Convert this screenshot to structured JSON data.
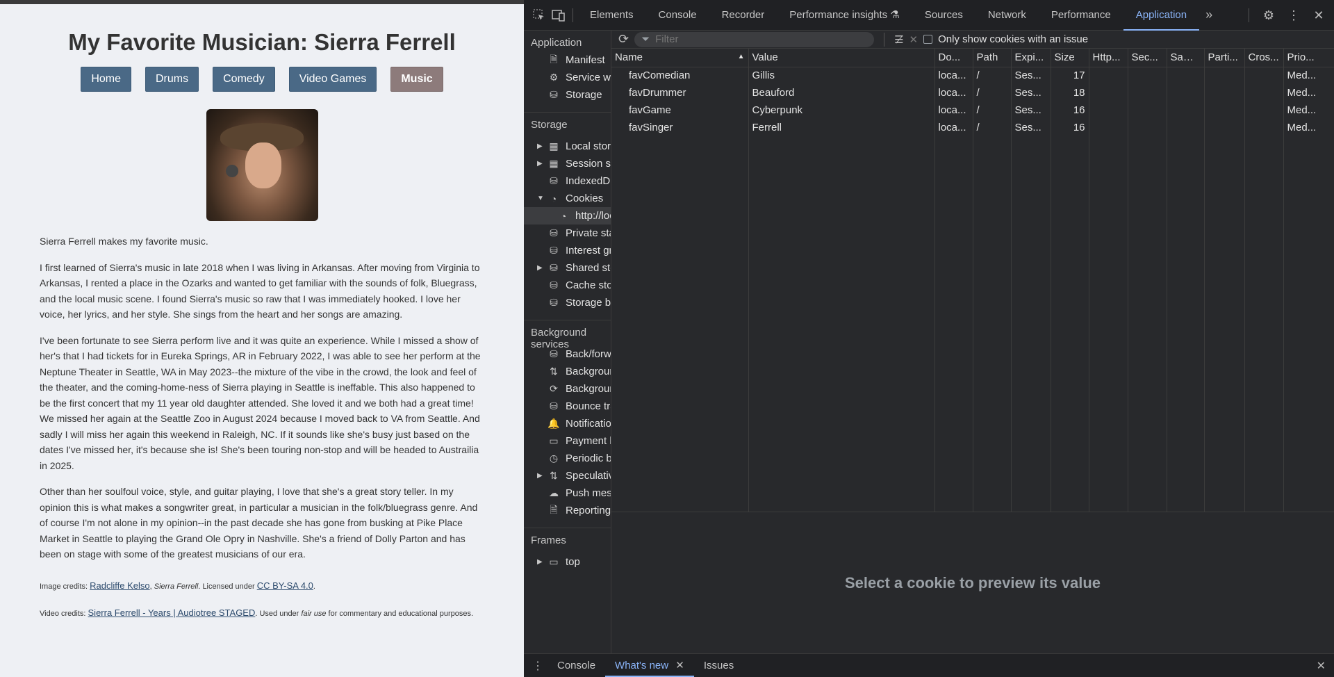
{
  "page": {
    "title": "My Favorite Musician: Sierra Ferrell",
    "nav": [
      "Home",
      "Drums",
      "Comedy",
      "Video Games",
      "Music"
    ],
    "active_nav": "Music",
    "paragraphs": [
      "Sierra Ferrell makes my favorite music.",
      "I first learned of Sierra's music in late 2018 when I was living in Arkansas. After moving from Virginia to Arkansas, I rented a place in the Ozarks and wanted to get familiar with the sounds of folk, Bluegrass, and the local music scene. I found Sierra's music so raw that I was immediately hooked. I love her voice, her lyrics, and her style. She sings from the heart and her songs are amazing.",
      "I've been fortunate to see Sierra perform live and it was quite an experience. While I missed a show of her's that I had tickets for in Eureka Springs, AR in February 2022, I was able to see her perform at the Neptune Theater in Seattle, WA in May 2023--the mixture of the vibe in the crowd, the look and feel of the theater, and the coming-home-ness of Sierra playing in Seattle is ineffable. This also happened to be the first concert that my 11 year old daughter attended. She loved it and we both had a great time! We missed her again at the Seattle Zoo in August 2024 because I moved back to VA from Seattle. And sadly I will miss her again this weekend in Raleigh, NC. If it sounds like she's busy just based on the dates I've missed her, it's because she is! She's been touring non-stop and will be headed to Austrailia in 2025.",
      "Other than her soulfoul voice, style, and guitar playing, I love that she's a great story teller. In my opinion this is what makes a songwriter great, in particular a musician in the folk/bluegrass genre. And of course I'm not alone in my opinion--in the past decade she has gone from busking at Pike Place Market in Seattle to playing the Grand Ole Opry in Nashville. She's a friend of Dolly Parton and has been on stage with some of the greatest musicians of our era."
    ],
    "image_credits": {
      "prefix": "Image credits: ",
      "link": "Radcliffe Kelso",
      "work": "Sierra Ferrell",
      "licensed": ". Licensed under ",
      "license_link": "CC BY-SA 4.0",
      "end": "."
    },
    "video_credits": {
      "prefix": "Video credits: ",
      "link": "Sierra Ferrell - Years | Audiotree STAGED",
      "suffix1": ". Used under ",
      "fair": "fair use",
      "suffix2": " for commentary and educational purposes."
    }
  },
  "devtools": {
    "tabs": [
      "Elements",
      "Console",
      "Recorder",
      "Performance insights",
      "Sources",
      "Network",
      "Performance",
      "Application"
    ],
    "active_tab": "Application",
    "sidebar": {
      "application_header": "Application",
      "application_items": [
        "Manifest",
        "Service workers",
        "Storage"
      ],
      "storage_header": "Storage",
      "storage_items": [
        "Local storage",
        "Session storage",
        "IndexedDB",
        "Cookies",
        "http://localhost",
        "Private state tokens",
        "Interest groups",
        "Shared storage",
        "Cache storage",
        "Storage buckets"
      ],
      "background_header": "Background services",
      "background_items": [
        "Back/forward cache",
        "Background fetch",
        "Background sync",
        "Bounce tracking mitigations",
        "Notifications",
        "Payment handler",
        "Periodic background sync",
        "Speculative loads",
        "Push messaging",
        "Reporting API"
      ],
      "frames_header": "Frames",
      "frames_items": [
        "top"
      ]
    },
    "toolbar": {
      "filter_placeholder": "Filter",
      "only_issues_label": "Only show cookies with an issue"
    },
    "columns": [
      "Name",
      "Value",
      "Do...",
      "Path",
      "Expi...",
      "Size",
      "Http...",
      "Sec...",
      "Sam...",
      "Parti...",
      "Cros...",
      "Prio..."
    ],
    "cookies": [
      {
        "name": "favComedian",
        "value": "Gillis",
        "domain": "loca...",
        "path": "/",
        "expires": "Ses...",
        "size": "17",
        "priority": "Med..."
      },
      {
        "name": "favDrummer",
        "value": "Beauford",
        "domain": "loca...",
        "path": "/",
        "expires": "Ses...",
        "size": "18",
        "priority": "Med..."
      },
      {
        "name": "favGame",
        "value": "Cyberpunk",
        "domain": "loca...",
        "path": "/",
        "expires": "Ses...",
        "size": "16",
        "priority": "Med..."
      },
      {
        "name": "favSinger",
        "value": "Ferrell",
        "domain": "loca...",
        "path": "/",
        "expires": "Ses...",
        "size": "16",
        "priority": "Med..."
      }
    ],
    "preview_text": "Select a cookie to preview its value",
    "drawer_tabs": [
      "Console",
      "What's new",
      "Issues"
    ],
    "active_drawer": "What's new"
  }
}
